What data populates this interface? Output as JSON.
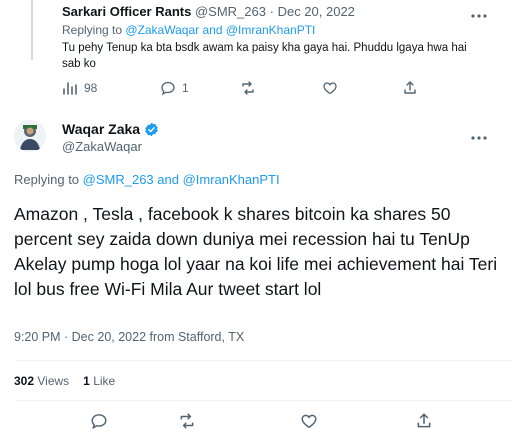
{
  "reply_tweet": {
    "author_name": "Sarkari Officer Rants",
    "author_handle": "@SMR_263",
    "date": "Dec 20, 2022",
    "separator": "·",
    "replying_prefix": "Replying to ",
    "replying_to": "@ZakaWaqar and @ImranKhanPTI",
    "text": "Tu pehy Tenup ka bta bsdk awam ka paisy kha gaya hai. Phuddu lgaya hwa hai sab ko",
    "views_count": "98",
    "replies_count": "1"
  },
  "main_tweet": {
    "author_name": "Waqar Zaka",
    "author_handle": "@ZakaWaqar",
    "replying_prefix": "Replying to ",
    "replying_to": "@SMR_263 and @ImranKhanPTI",
    "text": "Amazon , Tesla , facebook k shares bitcoin ka shares 50 percent sey zaida down duniya mei recession hai tu TenUp Akelay pump hoga lol yaar na koi life mei achievement hai Teri lol bus free Wi-Fi Mila Aur tweet start lol",
    "timestamp": "9:20 PM · Dec 20, 2022 from Stafford, TX",
    "views_count": "302",
    "views_label": "Views",
    "likes_count": "1",
    "likes_label": "Like"
  },
  "icons": {
    "more": "more-icon",
    "views": "views-icon",
    "reply": "reply-icon",
    "retweet": "retweet-icon",
    "like": "like-icon",
    "share": "share-icon",
    "verified": "verified-badge-icon"
  },
  "colors": {
    "accent": "#1d9bf0",
    "text": "#0f1419",
    "muted": "#536471",
    "divider": "#eff3f4"
  }
}
